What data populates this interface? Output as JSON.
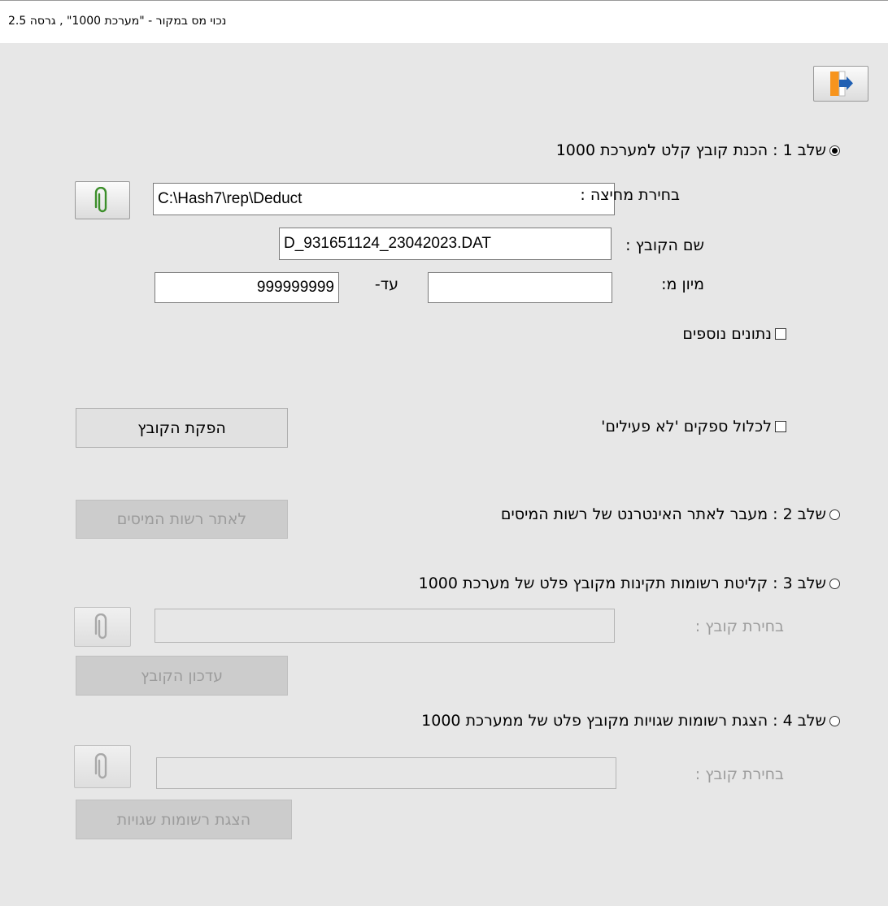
{
  "window": {
    "title": "נכוי מס במקור - \"מערכת 1000\" , גרסה 2.5"
  },
  "exit_button": {
    "icon": "exit-door-icon"
  },
  "step1": {
    "label": "שלב 1 : הכנת קובץ קלט למערכת 1000",
    "selected": true,
    "folder_label": "בחירת מחיצה :",
    "folder_value": "C:\\Hash7\\rep\\Deduct",
    "filename_label": "שם הקובץ :",
    "filename_value": "D_931651124_23042023.DAT",
    "sort_label": "מיון מ:",
    "sort_from_value": "",
    "sort_to_label": "עד-",
    "sort_to_value": "999999999",
    "extra_data_label": "נתונים נוספים",
    "include_inactive_label": "לכלול ספקים 'לא פעילים'",
    "produce_button": "הפקת הקובץ"
  },
  "step2": {
    "label": "שלב 2 : מעבר לאתר האינטרנט של רשות המיסים",
    "selected": false,
    "site_button": "לאתר רשות המיסים"
  },
  "step3": {
    "label": "שלב 3 : קליטת רשומות תקינות מקובץ פלט של מערכת 1000",
    "selected": false,
    "file_label": "בחירת קובץ :",
    "file_value": "",
    "update_button": "עדכון הקובץ"
  },
  "step4": {
    "label": "שלב 4 : הצגת רשומות שגויות מקובץ פלט של ממערכת 1000",
    "selected": false,
    "file_label": "בחירת קובץ :",
    "file_value": "",
    "show_button": "הצגת רשומות שגויות"
  }
}
